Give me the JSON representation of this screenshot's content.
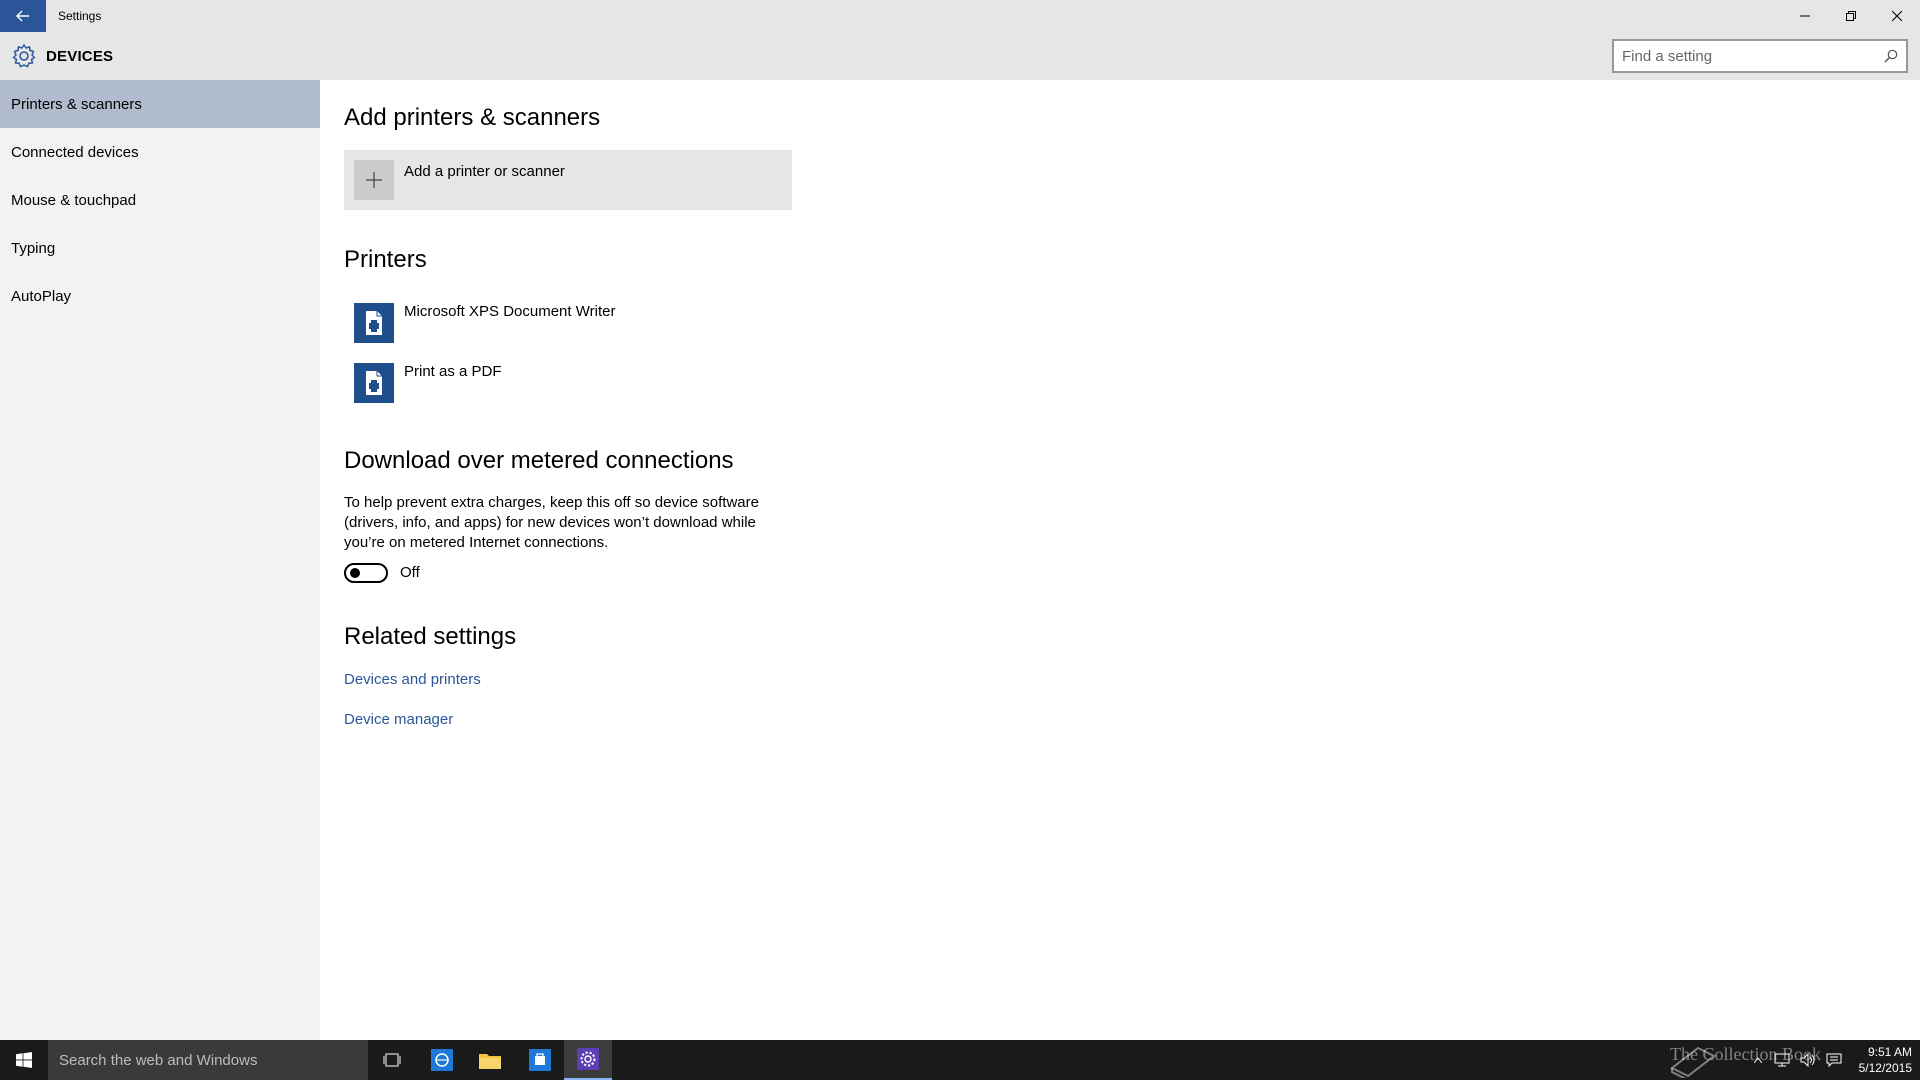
{
  "window": {
    "title": "Settings"
  },
  "header": {
    "section_title": "DEVICES",
    "search_placeholder": "Find a setting"
  },
  "sidebar": {
    "items": [
      {
        "label": "Printers & scanners",
        "selected": true
      },
      {
        "label": "Connected devices",
        "selected": false
      },
      {
        "label": "Mouse & touchpad",
        "selected": false
      },
      {
        "label": "Typing",
        "selected": false
      },
      {
        "label": "AutoPlay",
        "selected": false
      }
    ]
  },
  "main": {
    "add_heading": "Add printers & scanners",
    "add_button_label": "Add a printer or scanner",
    "printers_heading": "Printers",
    "printers": [
      {
        "name": "Microsoft XPS Document Writer"
      },
      {
        "name": "Print as a PDF"
      }
    ],
    "metered_heading": "Download over metered connections",
    "metered_description": "To help prevent extra charges, keep this off so device software (drivers, info, and apps) for new devices won’t download while you’re on metered Internet connections.",
    "metered_toggle": {
      "state": "Off",
      "on": false
    },
    "related_heading": "Related settings",
    "related_links": [
      {
        "label": "Devices and printers"
      },
      {
        "label": "Device manager"
      }
    ]
  },
  "taskbar": {
    "search_placeholder": "Search the web and Windows",
    "apps": [
      "task-view-icon",
      "internet-explorer-icon",
      "file-explorer-icon",
      "store-icon",
      "settings-icon"
    ],
    "watermark": "The Collection Book",
    "clock_time": "9:51 AM",
    "clock_date": "5/12/2015"
  },
  "colors": {
    "accent": "#2b579a",
    "selected_nav": "#b0bccd",
    "chrome": "#e6e6e6",
    "sidebar": "#f2f2f2",
    "taskbar": "#1a1a1a"
  }
}
